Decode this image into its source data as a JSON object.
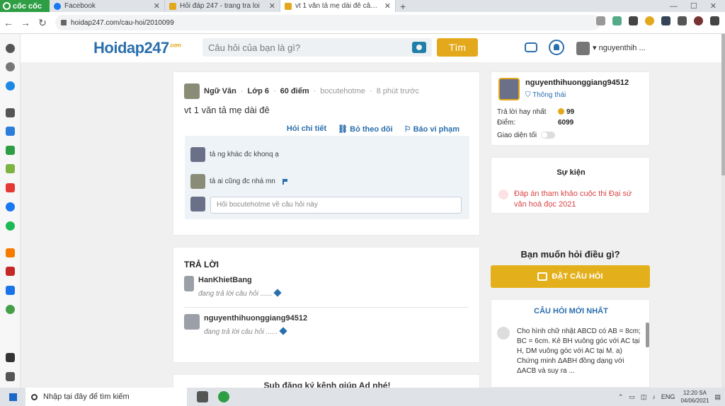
{
  "browser": {
    "brand": "cốc cốc",
    "tabs": [
      {
        "title": "Facebook",
        "active": false
      },
      {
        "title": "Hỏi đáp 247 - trang tra loi",
        "active": false
      },
      {
        "title": "vt 1 văn tả mẹ dài đê câu hỏi",
        "active": true
      }
    ],
    "url": "hoidap247.com/cau-hoi/2010099"
  },
  "site": {
    "logo": "Hoidap247",
    "logo_suffix": ".com",
    "search_placeholder": "Câu hỏi của bạn là gì?",
    "search_button": "Tìm",
    "username": "nguyenthih ..."
  },
  "question": {
    "subject": "Ngữ Văn",
    "grade": "Lớp 6",
    "points": "60 điểm",
    "author": "bocutehotme",
    "time": "8 phút trước",
    "text": "vt 1  văn tả mẹ dài đê",
    "actions": [
      "Hỏi chi tiết",
      "Bỏ theo dõi",
      "Báo vi phạm"
    ],
    "comments": [
      {
        "text": "tả ng khác đc khonq ạ"
      },
      {
        "text": "tả ai cũng đc nhá mn"
      }
    ],
    "comment_placeholder": "Hỏi bocutehotme về câu hỏi này"
  },
  "answers": {
    "title": "TRẢ LỜI",
    "items": [
      {
        "name": "HanKhietBang",
        "status": "đang trả lời câu hỏi ......"
      },
      {
        "name": "nguyenthihuonggiang94512",
        "status": "đang trả lời câu hỏi ......"
      }
    ]
  },
  "subscribe": "Sub đăng ký kênh giúp Ad nhé!",
  "user_card": {
    "name": "nguyenthihuonggiang94512",
    "info_link": "Thông thái",
    "best_answer_label": "Trả lời hay nhất",
    "best_answer_value": "99",
    "points_label": "Điểm:",
    "points_value": "6099",
    "dark_mode_label": "Giao diện tối"
  },
  "events": {
    "title": "Sự kiện",
    "item": "Đáp án tham khảo cuộc thi Đại sứ văn hoá đọc 2021"
  },
  "ask": {
    "title": "Bạn muốn hỏi điều gì?",
    "button": "ĐẶT CÂU HỎI"
  },
  "newest": {
    "title": "CÂU HỎI MỚI NHẤT",
    "text": "Cho hình chữ nhật ABCD có AB = 8cm; BC = 6cm. Kẻ BH vuông góc với AC tại H, DM vuông góc với AC tại M. a) Chứng minh ΔABH đồng dạng với ΔACB và suy ra ..."
  },
  "taskbar": {
    "search": "Nhập tại đây để tìm kiếm",
    "lang": "ENG",
    "time": "12:20 SA",
    "date": "04/06/2021"
  },
  "colors": {
    "accent": "#e3a81b",
    "link": "#2a6fad",
    "event": "#d94444"
  }
}
